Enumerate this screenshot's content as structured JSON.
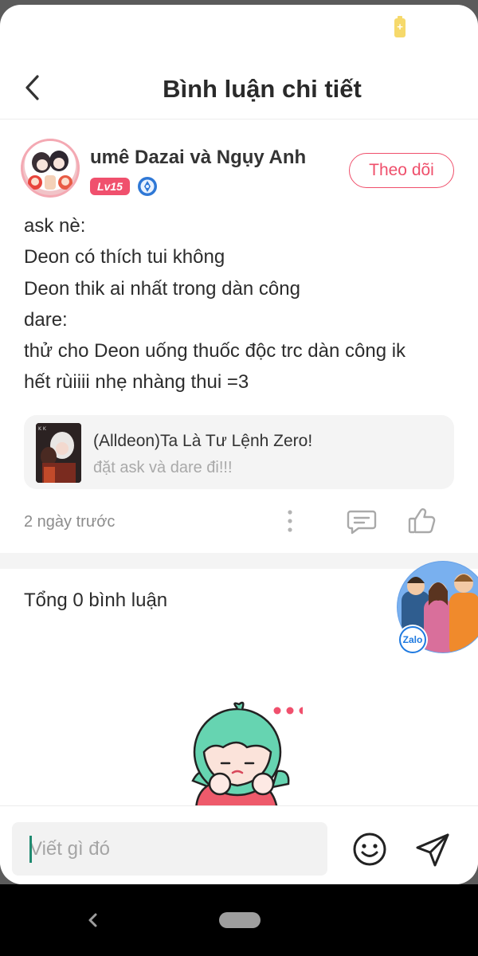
{
  "status_bar": {
    "battery_icon": "charging-battery-icon"
  },
  "header": {
    "title": "Bình luận chi tiết",
    "back_icon": "chevron-left-icon"
  },
  "post": {
    "author": "umê Dazai và Ngụy Anh",
    "level_badge": "Lv15",
    "follow_label": "Theo dõi",
    "body_lines": [
      "ask nè:",
      "Deon có thích tui không",
      "Deon thik ai nhất trong dàn công",
      "dare:",
      "thử cho Deon uống thuốc độc trc dàn công ik",
      "hết rùiiii nhẹ nhàng thui =3"
    ],
    "story": {
      "title": "(Alldeon)Ta Là Tư Lệnh Zero!",
      "subtitle": "đặt ask và dare đi!!!"
    },
    "time": "2 ngày trước",
    "colors": {
      "accent": "#ef4f6b",
      "level_badge": "#f0506d"
    }
  },
  "comments": {
    "total_label": "Tổng 0 bình luận"
  },
  "floating": {
    "zalo_label": "Zalo"
  },
  "composer": {
    "placeholder": "Viết gì đó"
  }
}
